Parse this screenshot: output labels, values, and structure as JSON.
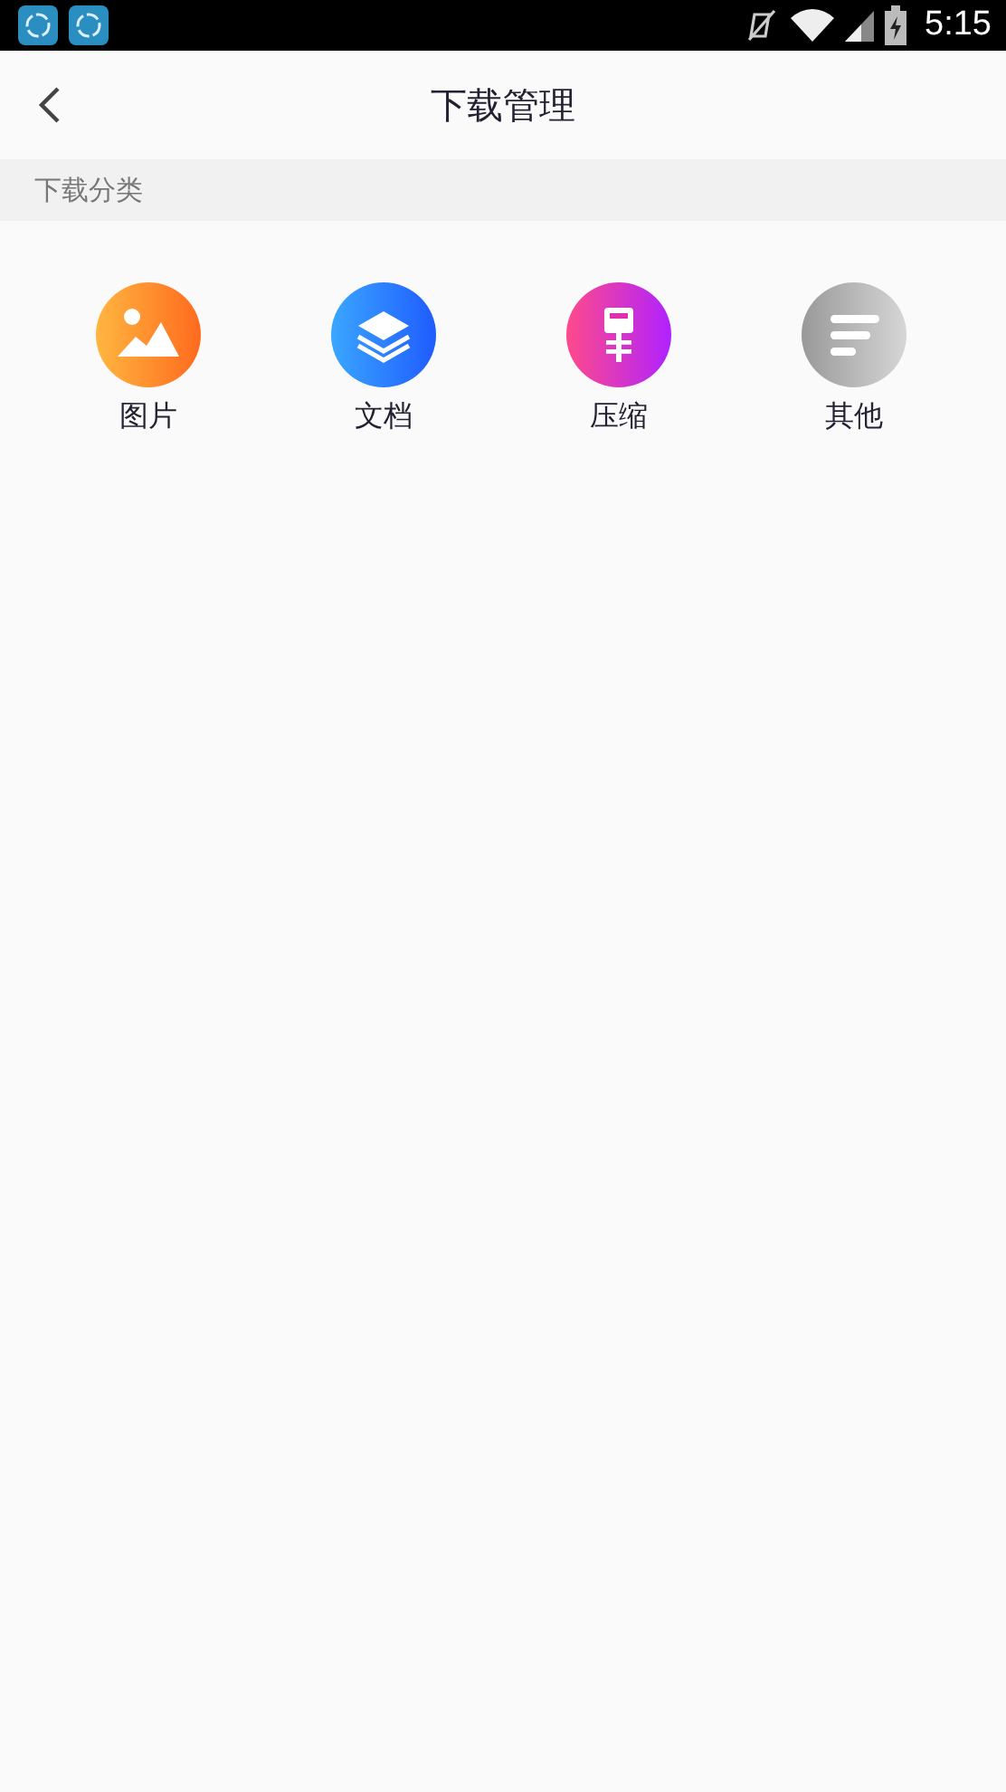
{
  "status_bar": {
    "time": "5:15"
  },
  "header": {
    "title": "下载管理"
  },
  "section": {
    "title": "下载分类"
  },
  "categories": [
    {
      "label": "图片",
      "kind": "image"
    },
    {
      "label": "文档",
      "kind": "document"
    },
    {
      "label": "压缩",
      "kind": "archive"
    },
    {
      "label": "其他",
      "kind": "other"
    }
  ]
}
